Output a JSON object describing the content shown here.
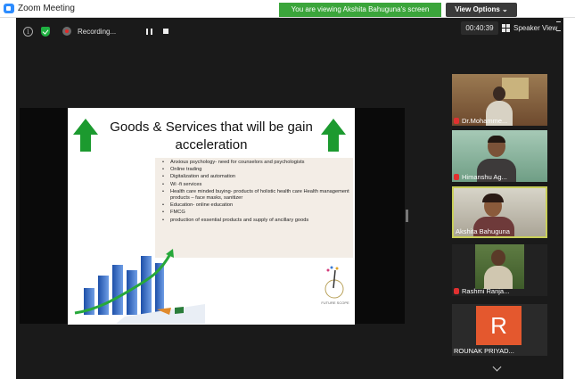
{
  "window": {
    "title": "Zoom Meeting",
    "banner": "You are viewing Akshita Bahuguna's screen",
    "view_options": "View Options ⌄"
  },
  "toolbar": {
    "recording_label": "Recording...",
    "timer": "00:40:39",
    "speaker_view": "Speaker View"
  },
  "slide": {
    "title_line1": "Goods & Services that will be gain",
    "title_line2": "acceleration",
    "bullets": [
      "Anxious psychology- need for counselors and psychologists",
      "Online trading",
      "Digitalization and automation",
      "Wi -fi services",
      "Health care minded buying- products of holistic  health care Health management products – face masks, sanitizer",
      "Education- online education",
      "FMCG",
      "production of essential products and supply of ancillary goods"
    ],
    "logo_text": "FUTURE SCOPE"
  },
  "participants": [
    {
      "name": "Dr.Mohamme...",
      "muted": true,
      "active": false
    },
    {
      "name": "Himanshu Ag...",
      "muted": true,
      "active": false
    },
    {
      "name": "Akshita Bahuguna",
      "muted": false,
      "active": true
    },
    {
      "name": "Rashmi Ranja...",
      "muted": true,
      "active": false
    },
    {
      "name": "ROUNAK PRIYAD...",
      "muted": false,
      "active": false,
      "initial": "R"
    }
  ],
  "colors": {
    "banner": "#3ba53b",
    "accent_arrow": "#1c9a2f",
    "active_border": "#c9cf5a",
    "avatar_bg": "#e4582e"
  }
}
